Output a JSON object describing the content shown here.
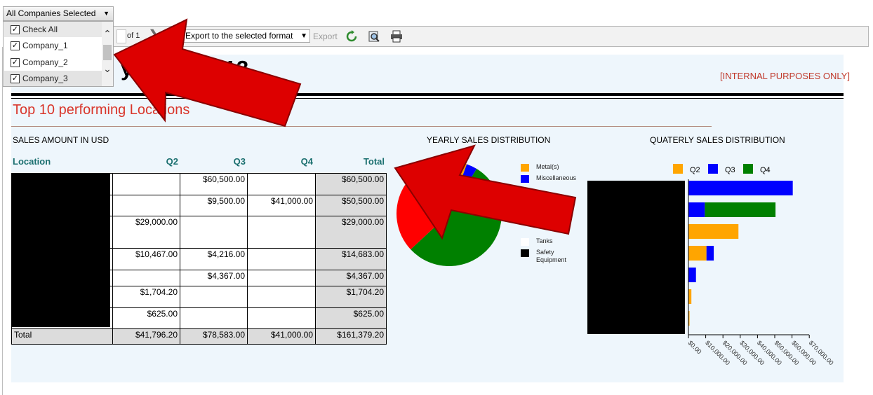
{
  "company_filter": {
    "selected_label": "All Companies Selected",
    "options": [
      {
        "label": "Check All",
        "checked": true
      },
      {
        "label": "Company_1",
        "checked": true
      },
      {
        "label": "Company_2",
        "checked": true
      },
      {
        "label": "Company_3",
        "checked": true
      }
    ]
  },
  "toolbar": {
    "page_of": "of 1",
    "export_format": "Export to the selected format",
    "export_label": "Export",
    "icons": [
      "refresh-icon",
      "print-preview-icon",
      "print-icon"
    ]
  },
  "report": {
    "title_visible": "y S       2013",
    "internal_note": "[INTERNAL PURPOSES ONLY]",
    "section_title": "Top 10 performing Locations",
    "sales_title": "SALES AMOUNT IN USD",
    "yearly_title": "YEARLY SALES DISTRIBUTION",
    "quarterly_title": "QUATERLY SALES DISTRIBUTION"
  },
  "table": {
    "headers": {
      "location": "Location",
      "q2": "Q2",
      "q3": "Q3",
      "q4": "Q4",
      "total": "Total"
    },
    "rows": [
      {
        "q2": "",
        "q3": "$60,500.00",
        "q4": "",
        "total": "$60,500.00"
      },
      {
        "q2": "",
        "q3": "$9,500.00",
        "q4": "$41,000.00",
        "total": "$50,500.00"
      },
      {
        "q2": "$29,000.00",
        "q3": "",
        "q4": "",
        "total": "$29,000.00"
      },
      {
        "q2": "$10,467.00",
        "q3": "$4,216.00",
        "q4": "",
        "total": "$14,683.00"
      },
      {
        "q2": "",
        "q3": "$4,367.00",
        "q4": "",
        "total": "$4,367.00"
      },
      {
        "q2": "$1,704.20",
        "q3": "",
        "q4": "",
        "total": "$1,704.20"
      },
      {
        "q2": "$625.00",
        "q3": "",
        "q4": "",
        "total": "$625.00"
      }
    ],
    "total_row": {
      "label": "Total",
      "q2": "$41,796.20",
      "q3": "$78,583.00",
      "q4": "$41,000.00",
      "total": "$161,379.20"
    }
  },
  "chart_data": [
    {
      "type": "pie",
      "title": "YEARLY SALES DISTRIBUTION",
      "legend": [
        {
          "label": "Metal(s)",
          "color": "#ffa500"
        },
        {
          "label": "Miscellaneous",
          "color": "#0000ff"
        },
        {
          "label": "Tanks",
          "color": "#ffffff"
        },
        {
          "label": "Safety Equipment",
          "color": "#000000"
        }
      ],
      "legend_position": "right",
      "slices": [
        {
          "color": "#008000",
          "value": 41000
        },
        {
          "color": "#ff0000",
          "value": 29000
        },
        {
          "color": "#ffa500",
          "value": 3000
        },
        {
          "color": "#0000ff",
          "value": 2500
        }
      ]
    },
    {
      "type": "bar",
      "orientation": "horizontal",
      "stacked": true,
      "title": "QUATERLY SALES DISTRIBUTION",
      "legend_position": "top",
      "series": [
        {
          "name": "Q2",
          "color": "#ffa500",
          "values": [
            0,
            0,
            29000,
            10467,
            0,
            1704.2,
            625
          ]
        },
        {
          "name": "Q3",
          "color": "#0000ff",
          "values": [
            60500,
            9500,
            0,
            4216,
            4367,
            0,
            0
          ]
        },
        {
          "name": "Q4",
          "color": "#008000",
          "values": [
            0,
            41000,
            0,
            0,
            0,
            0,
            0
          ]
        }
      ],
      "xlim": [
        0,
        70000
      ],
      "x_ticks": [
        "$0.00",
        "$10,000.00",
        "$20,000.00",
        "$30,000.00",
        "$40,000.00",
        "$50,000.00",
        "$60,000.00",
        "$70,000.00"
      ]
    }
  ]
}
